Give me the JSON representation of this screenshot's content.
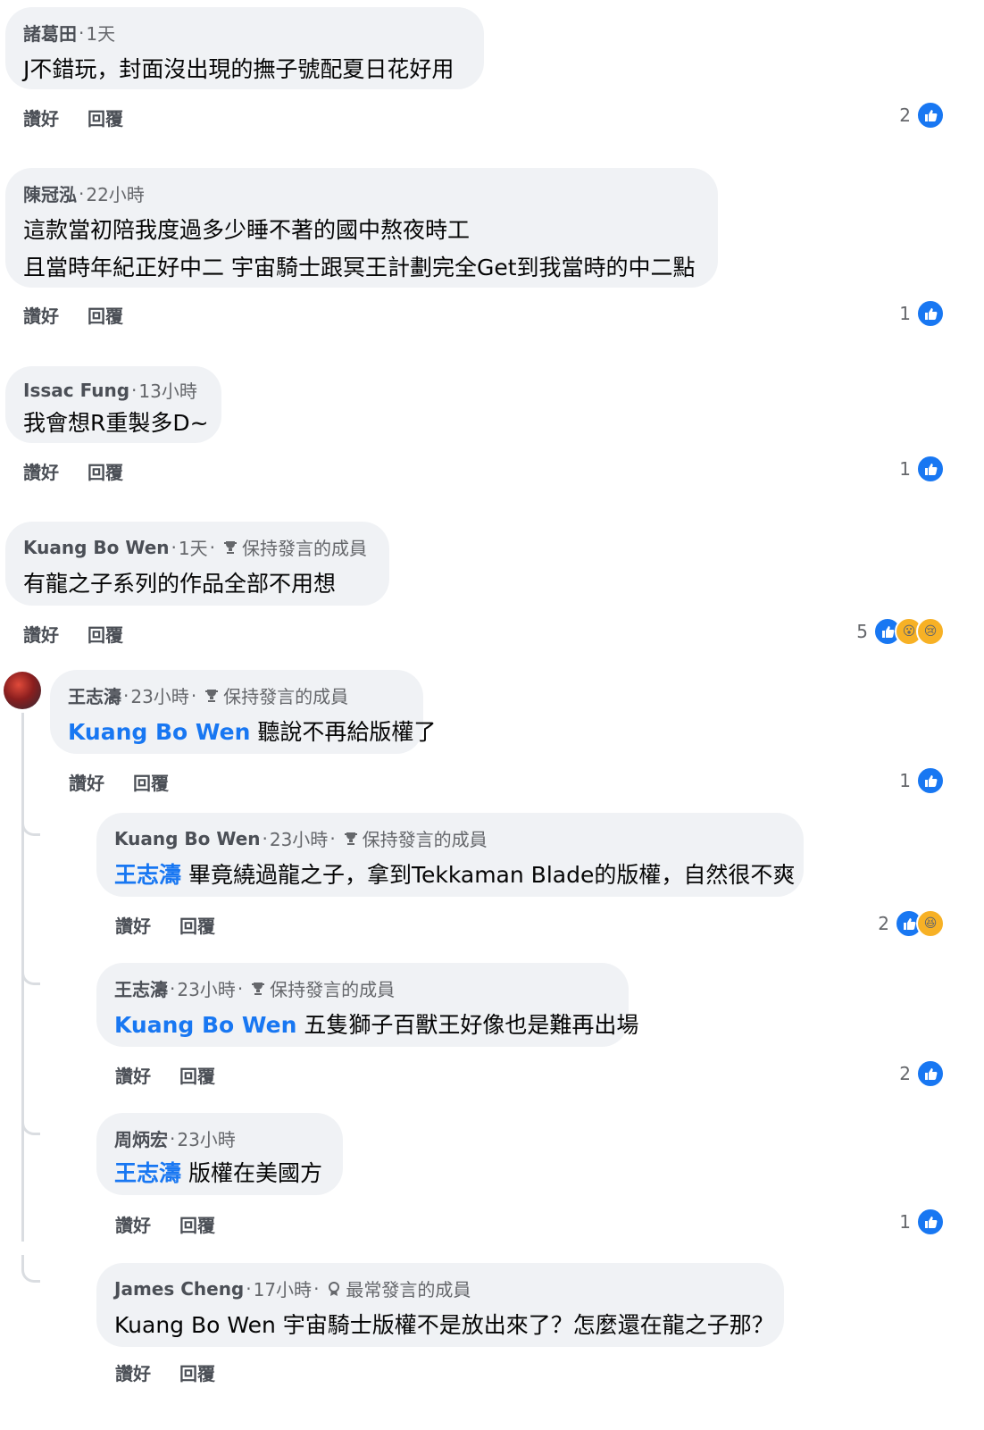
{
  "labels": {
    "like": "讚好",
    "reply": "回覆"
  },
  "comments": [
    {
      "name": "諸葛田",
      "time": "1天",
      "lines": [
        "J不錯玩，封面沒出現的撫子號配夏日花好用"
      ],
      "count": "2"
    },
    {
      "name": "陳冠泓",
      "time": "22小時",
      "lines": [
        "這款當初陪我度過多少睡不著的國中熬夜時工",
        "且當時年紀正好中二 宇宙騎士跟冥王計劃完全Get到我當時的中二點"
      ],
      "count": "1"
    },
    {
      "name": "Issac Fung",
      "time": "13小時",
      "lines": [
        "我會想R重製多D~"
      ],
      "count": "1"
    },
    {
      "name": "Kuang Bo Wen",
      "time": "1天",
      "badge": "保持發言的成員",
      "lines": [
        "有龍之子系列的作品全部不用想"
      ],
      "count": "5"
    }
  ],
  "replies": [
    {
      "name": "王志濤",
      "time": "23小時",
      "badge": "保持發言的成員",
      "mention": "Kuang Bo Wen",
      "text": "聽說不再給版權了",
      "count": "1"
    },
    {
      "name": "Kuang Bo Wen",
      "time": "23小時",
      "badge": "保持發言的成員",
      "mention": "王志濤",
      "text": "畢竟繞過龍之子，拿到Tekkaman Blade的版權，自然很不爽",
      "count": "2"
    },
    {
      "name": "王志濤",
      "time": "23小時",
      "badge": "保持發言的成員",
      "mention": "Kuang Bo Wen",
      "text": "五隻獅子百獸王好像也是難再出場",
      "count": "2"
    },
    {
      "name": "周炳宏",
      "time": "23小時",
      "mention": "王志濤",
      "text": "版權在美國方",
      "count": "1"
    },
    {
      "name": "James Cheng",
      "time": "17小時",
      "badge": "最常發言的成員",
      "text": "Kuang Bo Wen 宇宙騎士版權不是放出來了？怎麼還在龍之子那？"
    }
  ],
  "colors": {
    "bubble": "#f0f2f5",
    "mention": "#1877f2",
    "like": "#1877f2",
    "meta": "#65676b"
  },
  "icons": {
    "like": "like-icon",
    "wow": "wow-icon",
    "sad": "sad-icon",
    "haha": "haha-icon",
    "badge": "trophy-icon",
    "badge_alt": "top-contributor-icon"
  }
}
